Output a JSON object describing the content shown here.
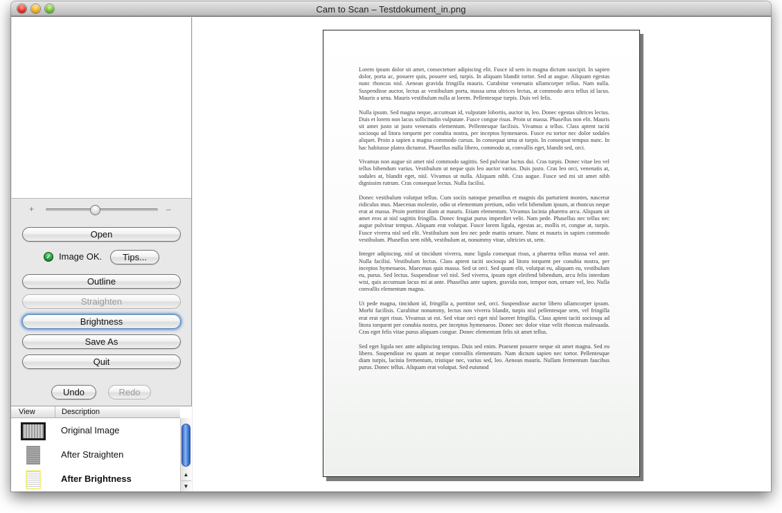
{
  "window": {
    "title": "Cam to Scan – Testdokument_in.png",
    "controls": [
      "close",
      "minimize",
      "zoom"
    ]
  },
  "left_panel": {
    "zoom_slider": {
      "plus_label": "+",
      "minus_label": "–",
      "value_fraction": 0.44
    },
    "buttons": {
      "open": "Open",
      "tips": "Tips...",
      "outline": "Outline",
      "straighten": "Straighten",
      "brightness": "Brightness",
      "save_as": "Save As",
      "quit": "Quit",
      "undo": "Undo",
      "redo": "Redo"
    },
    "button_states": {
      "straighten": "disabled",
      "redo": "disabled",
      "brightness": "focused"
    },
    "status": {
      "icon": "check-circle-icon",
      "text": "Image OK.",
      "color": "#1e9a3c"
    },
    "history": {
      "columns": [
        "View",
        "Description"
      ],
      "rows": [
        {
          "thumb": "original-image-thumbnail",
          "label": "Original Image",
          "bold": false
        },
        {
          "thumb": "straightened-image-thumbnail",
          "label": "After Straighten",
          "bold": false
        },
        {
          "thumb": "brightened-image-thumbnail",
          "label": "After Brightness",
          "bold": true
        }
      ]
    }
  },
  "document": {
    "paragraphs": [
      "Lorem ipsum dolor sit amet, consectetuer adipiscing elit. Fusce id sem in magna dictum suscipit. In sapien dolor, porta ac, posuere quis, posuere sed, turpis. In aliquam blandit tortor. Sed at augue. Aliquam egestas nunc rhoncus nisl. Aenean gravida fringilla mauris. Curabitur venenatis ullamcorper tellus. Nam nulla. Suspendisse auctor, lectus ac vestibulum porta, massa urna ultrices lectus, at commodo arcu tellus id lacus. Mauris a urna. Mauris vestibulum nulla at lorem. Pellentesque turpis. Duis vel felis.",
      "Nulla ipsum. Sed magna neque, accumsan id, vulputate lobortis, auctor in, leo. Donec egestas ultrices lectus. Duis et lorem non lacus sollicitudin vulputate. Fusce congue risus. Proin ut massa. Phasellus non elit. Mauris sit amet justo ut justo venenatis elementum. Pellentesque facilisis. Vivamus a tellus. Class aptent taciti sociosqu ad litora torquent per conubia nostra, per inceptos hymenaeos. Fusce eu tortor nec dolor sodales aliquet. Proin a sapien a magna commodo cursus. In consequat urna ut turpis. In consequat tempus nunc. In hac habitasse platea dictumst. Phasellus nulla libero, commodo at, convallis eget, blandit sed, orci.",
      "Vivamus non augue sit amet nisl commodo sagittis. Sed pulvinar luctus dui. Cras turpis. Donec vitae leo vel tellus bibendum varius. Vestibulum ut neque quis leo auctor varius. Duis justo. Cras leo orci, venenatis at, sodales at, blandit eget, nisl. Vivamus ut nulla. Aliquam nibh. Cras augue. Fusce sed mi sit amet nibh dignissim rutrum. Cras consequat lectus. Nulla facilisi.",
      "Donec vestibulum volutpat tellus. Cum sociis natoque penatibus et magnis dis parturient montes, nascetur ridiculus mus. Maecenas molestie, odio ut elementum pretium, odio velit bibendum ipsum, at rhoncus neque erat at massa. Proin porttitor diam at mauris. Etiam elementum. Vivamus lacinia pharetra arcu. Aliquam sit amet eros at nisl sagittis fringilla. Donec feugiat purus imperdiet velit. Nam pede. Phasellus nec tellus nec augue pulvinar tempus. Aliquam erat volutpat. Fusce lorem ligula, egestas ac, mollis et, congue at, turpis. Fusce viverra nisl sed elit. Vestibulum non leo nec pede mattis ornare. Nunc et mauris in sapien commodo vestibulum. Phasellus sem nibh, vestibulum at, nonummy vitae, ultricies ut, sem.",
      "Integer adipiscing, nisl ut tincidunt viverra, nunc ligula consequat risus, a pharetra tellus massa vel ante. Nulla facilisi. Vestibulum lectus. Class aptent taciti sociosqu ad litora torquent per conubia nostra, per inceptos hymenaeos. Maecenas quis massa. Sed ut orci. Sed quam elit, volutpat eu, aliquam eu, vestibulum eu, purus. Sed lectus. Suspendisse vel nisl. Sed viverra, ipsum eget eleifend bibendum, arcu felis interdum wisi, quis accumsan lacus mi at ante. Phasellus ante sapien, gravida non, tempor non, ornare vel, leo. Nulla convallis elementum magna.",
      "Ut pede magna, tincidunt id, fringilla a, porttitor sed, orci. Suspendisse auctor libero ullamcorper ipsum. Morbi facilisis. Curabitur nonummy, lectus non viverra blandit, turpis nisl pellentesque sem, vel fringilla erat erat eget risus. Vivamus ut est. Sed vitae orci eget nisl laoreet fringilla. Class aptent taciti sociosqu ad litora torquent per conubia nostra, per inceptos hymenaeos. Donec nec dolor vitae velit rhoncus malesuada. Cras eget felis vitae purus aliquam congue. Donec elementum felis sit amet tellus.",
      "Sed eget ligula nec ante adipiscing tempus. Duis sed enim. Praesent posuere neque sit amet magna. Sed eu libero. Suspendisse eu quam at neque convallis elementum. Nam dictum sapien nec tortor. Pellentesque diam turpis, lacinia fermentum, tristique nec, varius sed, leo. Aenean mauris. Nullam fermentum faucibus purus. Donec tellus. Aliquam erat volutpat. Sed euismod"
    ]
  }
}
